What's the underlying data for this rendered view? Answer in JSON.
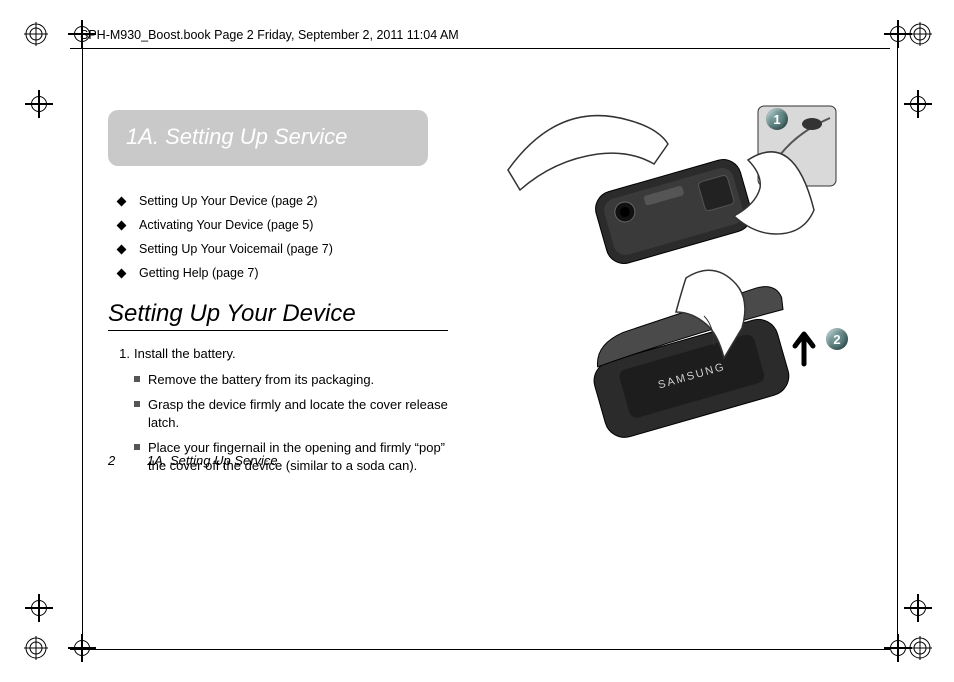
{
  "running_header": "SPH-M930_Boost.book  Page 2  Friday, September 2, 2011  11:04 AM",
  "section_title": "1A.  Setting Up Service",
  "toc": [
    "Setting Up Your Device (page 2)",
    "Activating Your Device (page 5)",
    "Setting Up Your Voicemail (page 7)",
    "Getting Help (page 7)"
  ],
  "heading": "Setting Up Your Device",
  "step_number": "1.",
  "step_text": "Install the battery.",
  "substeps": [
    "Remove the battery from its packaging.",
    "Grasp the device firmly and locate the cover release latch.",
    "Place your fingernail in the opening and firmly “pop” the cover off the device (similar to a soda can)."
  ],
  "footer": {
    "page": "2",
    "section": "1A. Setting Up Service"
  },
  "illus": {
    "badge1": "1",
    "badge2": "2",
    "device_brand": "SAMSUNG"
  }
}
